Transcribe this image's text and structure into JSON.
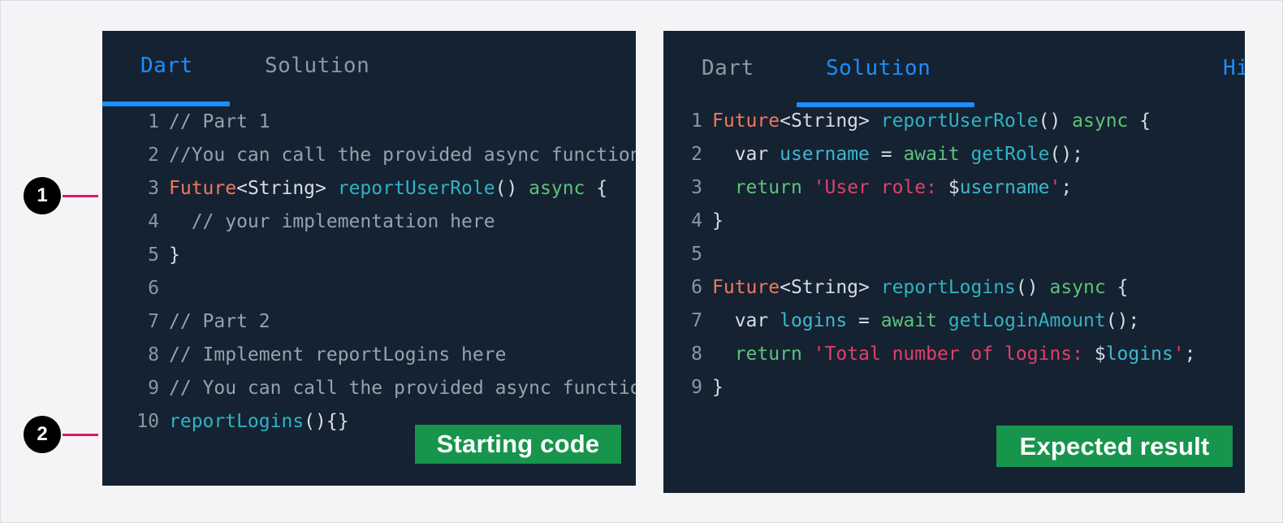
{
  "left_panel": {
    "tabs": [
      {
        "label": "Dart",
        "active": true
      },
      {
        "label": "Solution",
        "active": false
      }
    ],
    "code_lines": [
      {
        "number": "1",
        "tokens": [
          {
            "text": "// Part 1",
            "type": "comment"
          }
        ]
      },
      {
        "number": "2",
        "tokens": [
          {
            "text": "//You can call the provided async function",
            "type": "comment"
          }
        ]
      },
      {
        "number": "3",
        "tokens": [
          {
            "text": "Future",
            "type": "type"
          },
          {
            "text": "<String>",
            "type": "plain"
          },
          {
            "text": " ",
            "type": "plain"
          },
          {
            "text": "reportUserRole",
            "type": "fn"
          },
          {
            "text": "()",
            "type": "punc"
          },
          {
            "text": " ",
            "type": "plain"
          },
          {
            "text": "async",
            "type": "kw"
          },
          {
            "text": " {",
            "type": "punc"
          }
        ]
      },
      {
        "number": "4",
        "tokens": [
          {
            "text": "  // your implementation here",
            "type": "comment"
          }
        ]
      },
      {
        "number": "5",
        "tokens": [
          {
            "text": "}",
            "type": "punc"
          }
        ]
      },
      {
        "number": "6",
        "tokens": [
          {
            "text": "",
            "type": "plain"
          }
        ]
      },
      {
        "number": "7",
        "tokens": [
          {
            "text": "// Part 2",
            "type": "comment"
          }
        ]
      },
      {
        "number": "8",
        "tokens": [
          {
            "text": "// Implement reportLogins here",
            "type": "comment"
          }
        ]
      },
      {
        "number": "9",
        "tokens": [
          {
            "text": "// You can call the provided async function",
            "type": "comment"
          }
        ]
      },
      {
        "number": "10",
        "tokens": [
          {
            "text": "reportLogins",
            "type": "fn"
          },
          {
            "text": "(){}",
            "type": "punc"
          }
        ]
      }
    ],
    "badge_label": "Starting code"
  },
  "right_panel": {
    "tabs": [
      {
        "label": "Dart",
        "active": false
      },
      {
        "label": "Solution",
        "active": true
      },
      {
        "label": "Hi",
        "active": true
      }
    ],
    "code_lines": [
      {
        "number": "1",
        "tokens": [
          {
            "text": "Future",
            "type": "type"
          },
          {
            "text": "<String>",
            "type": "plain"
          },
          {
            "text": " ",
            "type": "plain"
          },
          {
            "text": "reportUserRole",
            "type": "fn"
          },
          {
            "text": "()",
            "type": "punc"
          },
          {
            "text": " ",
            "type": "plain"
          },
          {
            "text": "async",
            "type": "kw"
          },
          {
            "text": " {",
            "type": "punc"
          }
        ]
      },
      {
        "number": "2",
        "tokens": [
          {
            "text": "  ",
            "type": "plain"
          },
          {
            "text": "var",
            "type": "plain"
          },
          {
            "text": " ",
            "type": "plain"
          },
          {
            "text": "username",
            "type": "var"
          },
          {
            "text": " = ",
            "type": "punc"
          },
          {
            "text": "await",
            "type": "kw"
          },
          {
            "text": " ",
            "type": "plain"
          },
          {
            "text": "getRole",
            "type": "fn"
          },
          {
            "text": "();",
            "type": "punc"
          }
        ]
      },
      {
        "number": "3",
        "tokens": [
          {
            "text": "  ",
            "type": "plain"
          },
          {
            "text": "return",
            "type": "kw"
          },
          {
            "text": " ",
            "type": "plain"
          },
          {
            "text": "'User role: ",
            "type": "str"
          },
          {
            "text": "$",
            "type": "plain"
          },
          {
            "text": "username",
            "type": "var"
          },
          {
            "text": "'",
            "type": "str"
          },
          {
            "text": ";",
            "type": "punc"
          }
        ]
      },
      {
        "number": "4",
        "tokens": [
          {
            "text": "}",
            "type": "punc"
          }
        ]
      },
      {
        "number": "5",
        "tokens": [
          {
            "text": "",
            "type": "plain"
          }
        ]
      },
      {
        "number": "6",
        "tokens": [
          {
            "text": "Future",
            "type": "type"
          },
          {
            "text": "<String>",
            "type": "plain"
          },
          {
            "text": " ",
            "type": "plain"
          },
          {
            "text": "reportLogins",
            "type": "fn"
          },
          {
            "text": "()",
            "type": "punc"
          },
          {
            "text": " ",
            "type": "plain"
          },
          {
            "text": "async",
            "type": "kw"
          },
          {
            "text": " {",
            "type": "punc"
          }
        ]
      },
      {
        "number": "7",
        "tokens": [
          {
            "text": "  ",
            "type": "plain"
          },
          {
            "text": "var",
            "type": "plain"
          },
          {
            "text": " ",
            "type": "plain"
          },
          {
            "text": "logins",
            "type": "var"
          },
          {
            "text": " = ",
            "type": "punc"
          },
          {
            "text": "await",
            "type": "kw"
          },
          {
            "text": " ",
            "type": "plain"
          },
          {
            "text": "getLoginAmount",
            "type": "fn"
          },
          {
            "text": "();",
            "type": "punc"
          }
        ]
      },
      {
        "number": "8",
        "tokens": [
          {
            "text": "  ",
            "type": "plain"
          },
          {
            "text": "return",
            "type": "kw"
          },
          {
            "text": " ",
            "type": "plain"
          },
          {
            "text": "'Total number of logins: ",
            "type": "str"
          },
          {
            "text": "$",
            "type": "plain"
          },
          {
            "text": "logins",
            "type": "var"
          },
          {
            "text": "'",
            "type": "str"
          },
          {
            "text": ";",
            "type": "punc"
          }
        ]
      },
      {
        "number": "9",
        "tokens": [
          {
            "text": "}",
            "type": "punc"
          }
        ]
      }
    ],
    "badge_label": "Expected result"
  },
  "markers": [
    {
      "number": "1"
    },
    {
      "number": "2"
    }
  ],
  "colors": {
    "page_background": "#f4f4f6",
    "panel_background": "#152231",
    "tab_active": "#1a8fff",
    "tab_inactive": "#8c98a4",
    "badge_green": "#17954d",
    "marker_circle": "#000000",
    "marker_line": "#d81b60"
  }
}
